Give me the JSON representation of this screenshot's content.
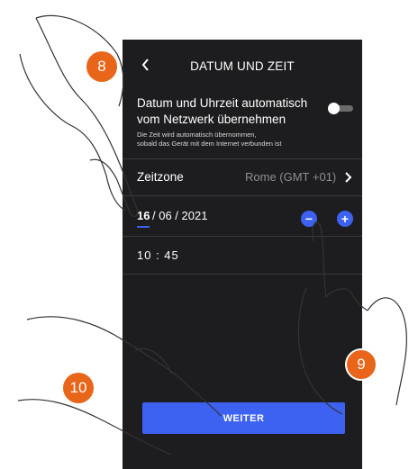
{
  "screen": {
    "title": "DATUM UND ZEIT",
    "auto_label_line1": "Datum und Uhrzeit automatisch",
    "auto_label_line2": "vom Netzwerk übernehmen",
    "auto_hint_line1": "Die Zeit wird automatisch übernommen,",
    "auto_hint_line2": "sobald das Gerät mit dem Internet verbunden ist",
    "auto_toggle_on": false,
    "timezone_label": "Zeitzone",
    "timezone_value": "Rome (GMT +01)",
    "date_day": "16",
    "date_rest": "/ 06 / 2021",
    "time_value": "10 : 45",
    "decrement_symbol": "−",
    "increment_symbol": "+",
    "weiter_label": "WEITER"
  },
  "callouts": [
    "8",
    "9",
    "10"
  ],
  "colors": {
    "accent": "#3d62f2",
    "callout": "#e8651a",
    "panel": "#1d1d1f"
  },
  "icons": [
    "back-chevron-icon",
    "toggle-switch",
    "chevron-right-icon",
    "minus-circle-icon",
    "plus-circle-icon"
  ]
}
